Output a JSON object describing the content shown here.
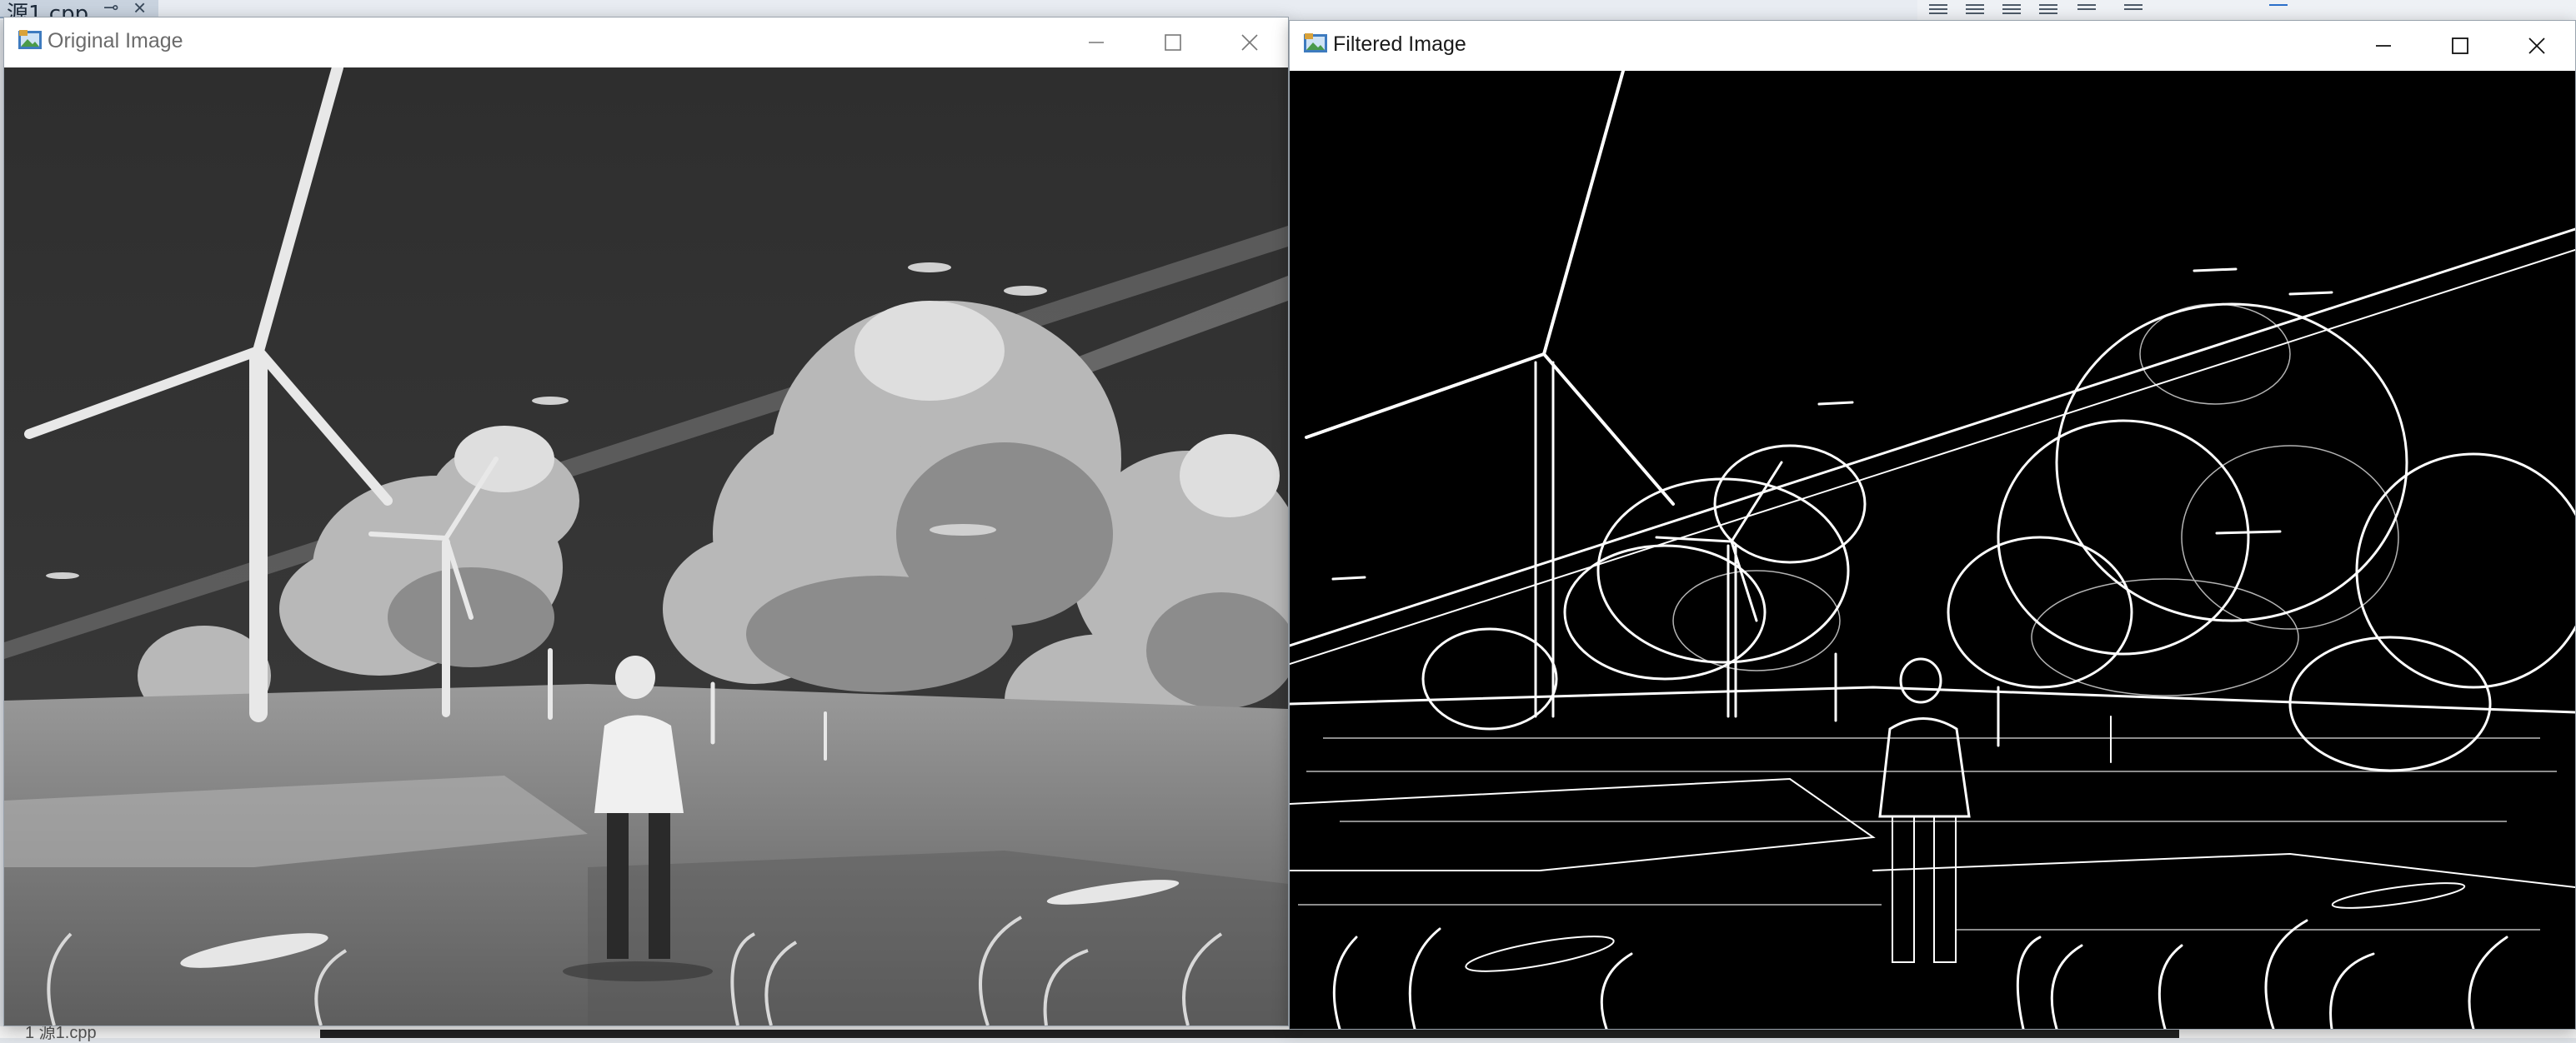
{
  "ide": {
    "tab_label": "源1.cpp",
    "bottom_label": "1 源1.cpp"
  },
  "windows": [
    {
      "title": "Original Image",
      "active": false,
      "title_color": "#6b6b6b"
    },
    {
      "title": "Filtered Image",
      "active": true,
      "title_color": "#1a1a1a"
    }
  ],
  "icons": {
    "app": "image-window-icon",
    "minimize": "minimize-icon",
    "maximize": "maximize-icon",
    "close": "close-icon"
  }
}
